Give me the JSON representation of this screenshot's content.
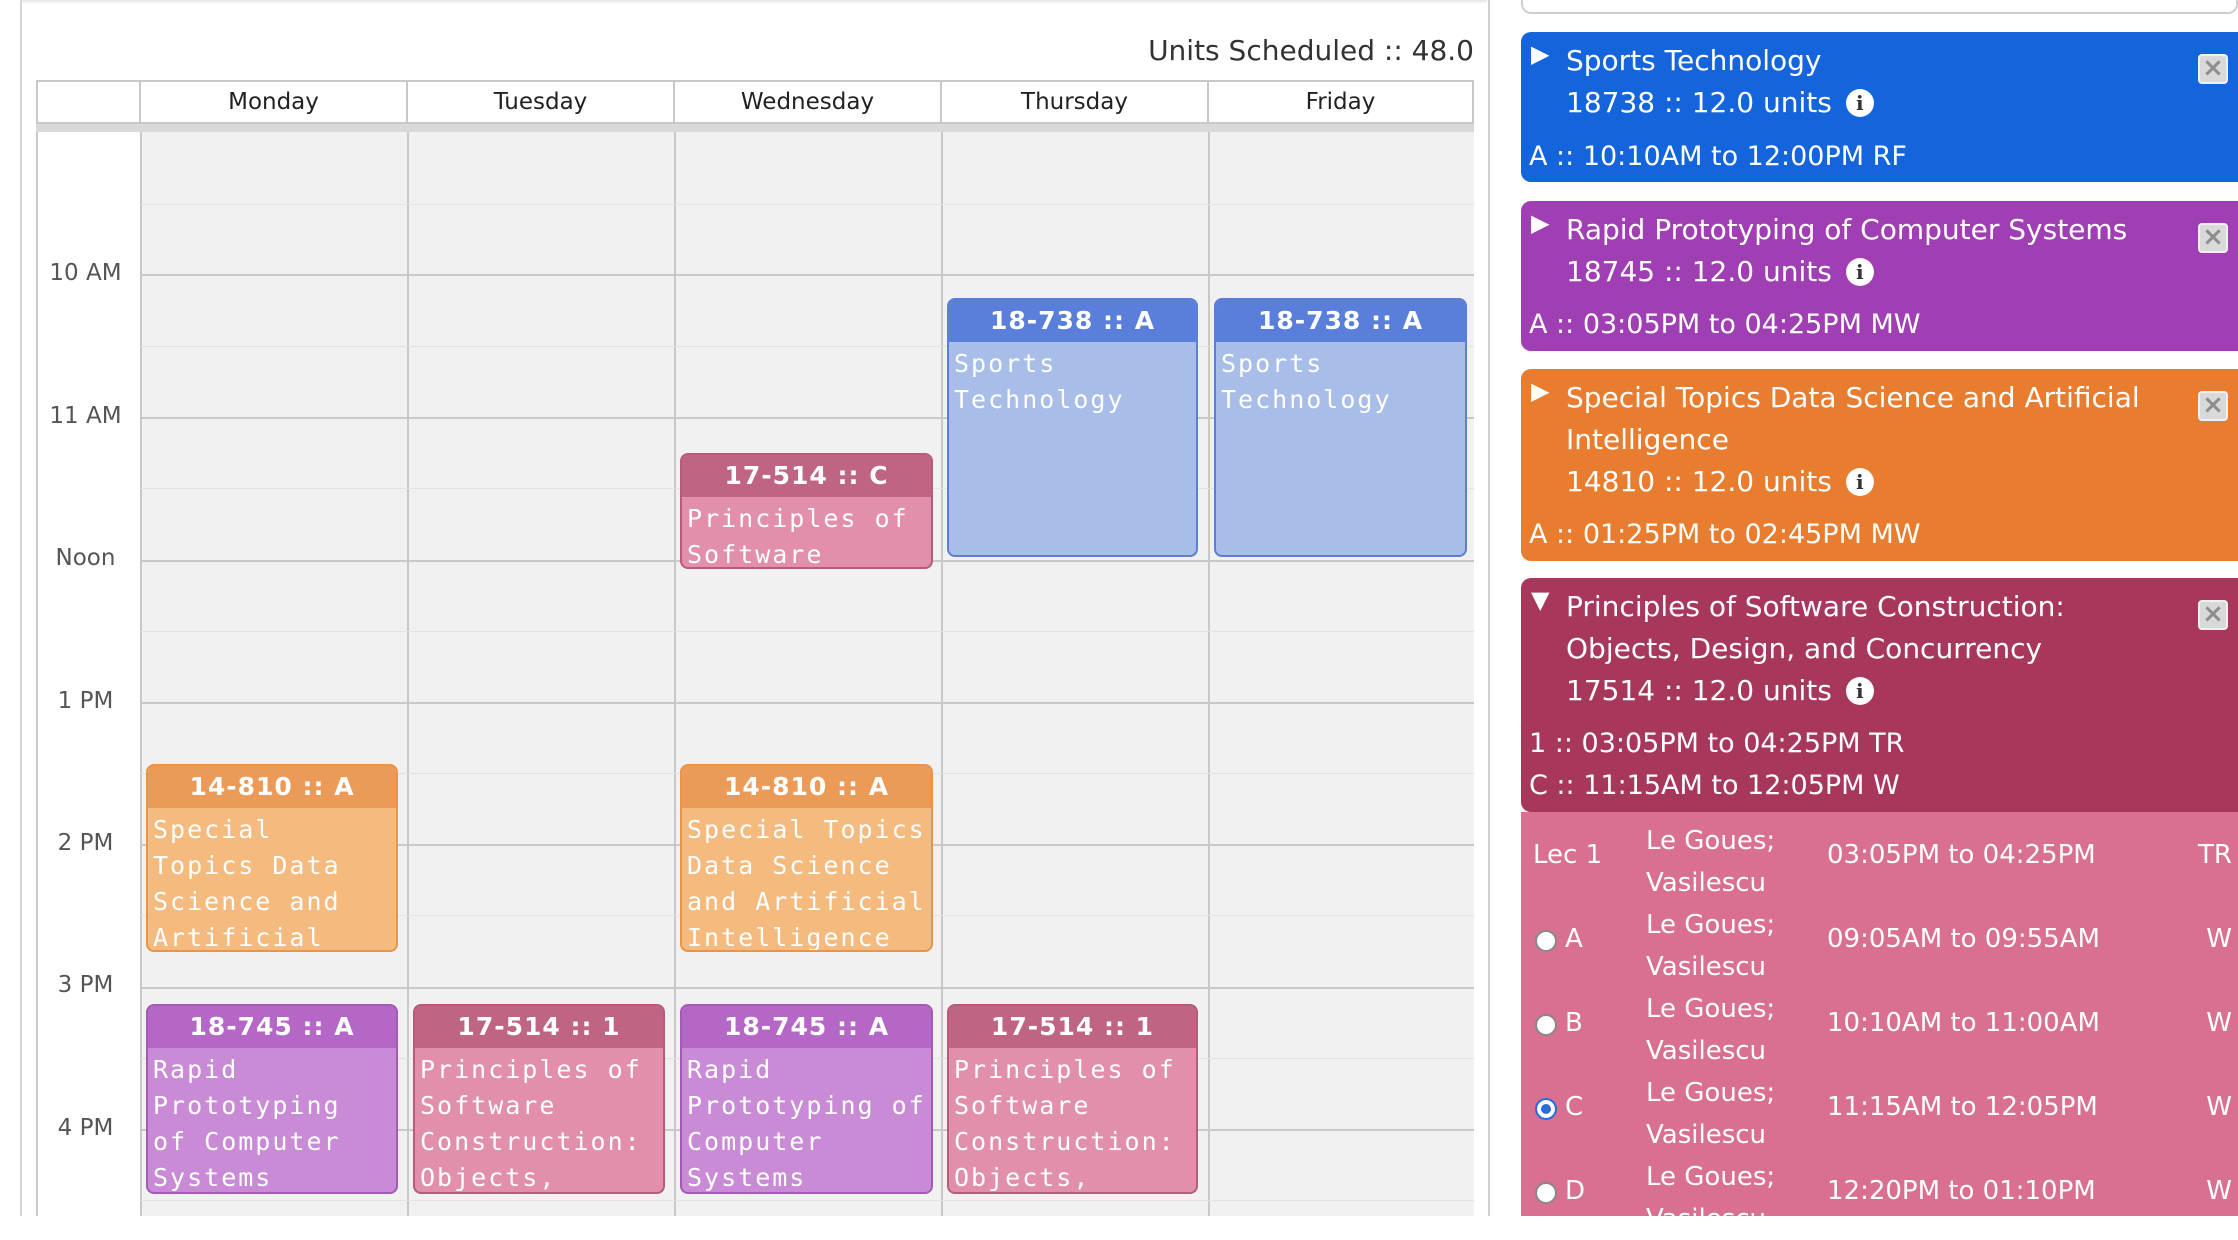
{
  "units_scheduled": "Units Scheduled :: 48.0",
  "days": [
    "Monday",
    "Tuesday",
    "Wednesday",
    "Thursday",
    "Friday"
  ],
  "hours": [
    "10 AM",
    "11 AM",
    "Noon",
    "1 PM",
    "2 PM",
    "3 PM",
    "4 PM"
  ],
  "events": {
    "thu_sports": {
      "head": "18-738 :: A",
      "body": "Sports Technology"
    },
    "fri_sports": {
      "head": "18-738 :: A",
      "body": "Sports Technology"
    },
    "wed_pos_c": {
      "head": "17-514 :: C",
      "body": "Principles of Software"
    },
    "mon_ds": {
      "head": "14-810 :: A",
      "body": "Special Topics Data Science and Artificial Intelligence"
    },
    "wed_ds": {
      "head": "14-810 :: A",
      "body": "Special Topics Data Science and Artificial Intelligence"
    },
    "mon_rp": {
      "head": "18-745 :: A",
      "body": "Rapid Prototyping of Computer Systems"
    },
    "tue_pos": {
      "head": "17-514 :: 1",
      "body": "Principles of Software Construction: Objects, Design,"
    },
    "wed_rp": {
      "head": "18-745 :: A",
      "body": "Rapid Prototyping of Computer Systems"
    },
    "thu_pos": {
      "head": "17-514 :: 1",
      "body": "Principles of Software Construction: Objects, Design,"
    }
  },
  "courses": [
    {
      "title": "Sports Technology",
      "units": "18738 :: 12.0 units",
      "sections": [
        "A :: 10:10AM to 12:00PM RF"
      ],
      "color": "#1464dc"
    },
    {
      "title": "Rapid Prototyping of Computer Systems",
      "units": "18745 :: 12.0 units",
      "sections": [
        "A :: 03:05PM to 04:25PM MW"
      ],
      "color": "#a03fb4"
    },
    {
      "title": "Special Topics Data Science and Artificial Intelligence",
      "units": "14810 :: 12.0 units",
      "sections": [
        "A :: 01:25PM to 02:45PM MW"
      ],
      "color": "#e87d2f"
    },
    {
      "title": "Principles of Software Construction: Objects, Design, and Concurrency",
      "units": "17514 :: 12.0 units",
      "sections": [
        "1 :: 03:05PM to 04:25PM TR",
        "C :: 11:15AM to 12:05PM W"
      ],
      "color": "#a8375c"
    }
  ],
  "section_rows": [
    {
      "label": "Lec 1",
      "instructor": "Le Goues; Vasilescu",
      "time": "03:05PM to 04:25PM",
      "days": "TR",
      "radio": false,
      "selected": false
    },
    {
      "label": "A",
      "instructor": "Le Goues; Vasilescu",
      "time": "09:05AM to 09:55AM",
      "days": "W",
      "radio": true,
      "selected": false
    },
    {
      "label": "B",
      "instructor": "Le Goues; Vasilescu",
      "time": "10:10AM to 11:00AM",
      "days": "W",
      "radio": true,
      "selected": false
    },
    {
      "label": "C",
      "instructor": "Le Goues; Vasilescu",
      "time": "11:15AM to 12:05PM",
      "days": "W",
      "radio": true,
      "selected": true
    },
    {
      "label": "D",
      "instructor": "Le Goues; Vasilescu",
      "time": "12:20PM to 01:10PM",
      "days": "W",
      "radio": true,
      "selected": false
    }
  ],
  "icons": {
    "expand": "triangle-right-icon",
    "collapse": "triangle-down-icon",
    "close": "close-icon",
    "info": "info-icon"
  }
}
